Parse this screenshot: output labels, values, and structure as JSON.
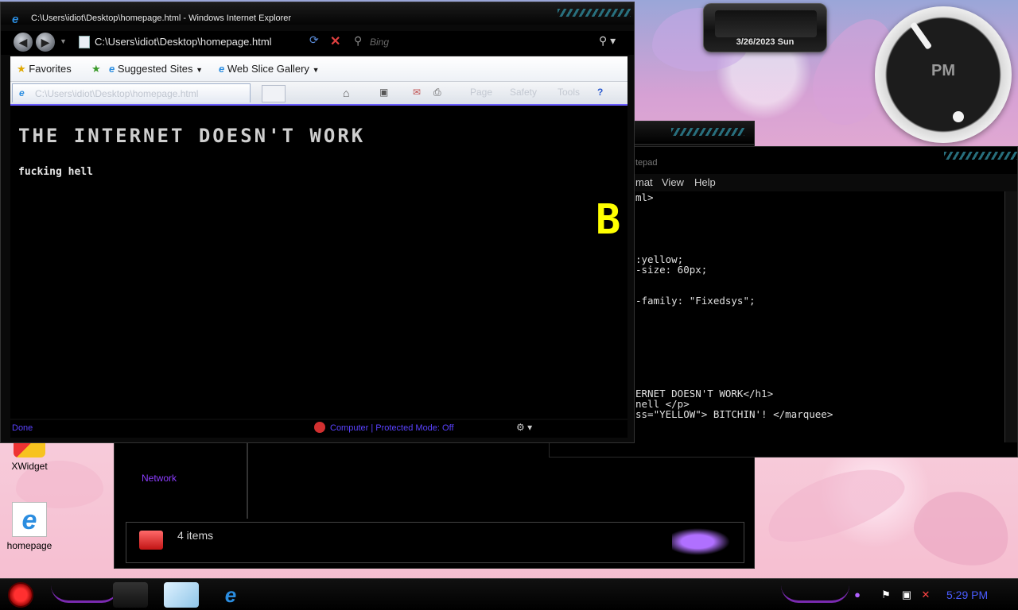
{
  "desktop": {
    "date_gadget": {
      "date": "3/26/2023 Sun"
    },
    "clock_gadget": {
      "ampm": "PM"
    },
    "icons": [
      {
        "label": "XWidget"
      },
      {
        "label": "homepage"
      }
    ]
  },
  "ie": {
    "title": "C:\\Users\\idiot\\Desktop\\homepage.html - Windows Internet Explorer",
    "address": "C:\\Users\\idiot\\Desktop\\homepage.html",
    "search_placeholder": "Bing",
    "favorites": {
      "label": "Favorites",
      "suggested": "Suggested Sites",
      "slice": "Web Slice Gallery"
    },
    "tab_title": "C:\\Users\\idiot\\Desktop\\homepage.html",
    "commands": {
      "page": "Page",
      "safety": "Safety",
      "tools": "Tools"
    },
    "page": {
      "heading": "THE INTERNET DOESN'T WORK",
      "paragraph": "fucking hell",
      "marquee_visible": "B"
    },
    "status": {
      "done": "Done",
      "zone": "Computer | Protected Mode: Off"
    },
    "colors": {
      "marquee": "#ffff00",
      "status": "#5a42ff"
    }
  },
  "notepad": {
    "title": "tepad",
    "menu": [
      "mat",
      "View",
      "Help"
    ],
    "lines": [
      {
        "text": "ml>"
      },
      {
        "text": ":yellow;"
      },
      {
        "text": "-size: 60px;"
      },
      {
        "text": "-family: \"Fixedsys\";"
      },
      {
        "text": "ERNET DOESN'T WORK</h1>"
      },
      {
        "text": "nell </p>"
      },
      {
        "text": "ss=\"YELLOW\"> BITCHIN'! </marquee>"
      }
    ]
  },
  "explorer": {
    "nav_items": [
      "Network"
    ],
    "status_count": "4 items"
  },
  "taskbar": {
    "time": "5:29 PM"
  }
}
